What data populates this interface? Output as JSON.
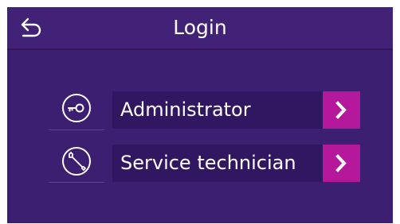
{
  "header": {
    "title": "Login",
    "back_icon": "back-arrow-icon"
  },
  "options": [
    {
      "label": "Administrator",
      "icon": "key-icon"
    },
    {
      "label": "Service technician",
      "icon": "wrench-icon"
    }
  ],
  "colors": {
    "background": "#3c1f70",
    "header": "#422277",
    "button": "#311762",
    "accent": "#b5189a",
    "text": "#ffffff"
  }
}
